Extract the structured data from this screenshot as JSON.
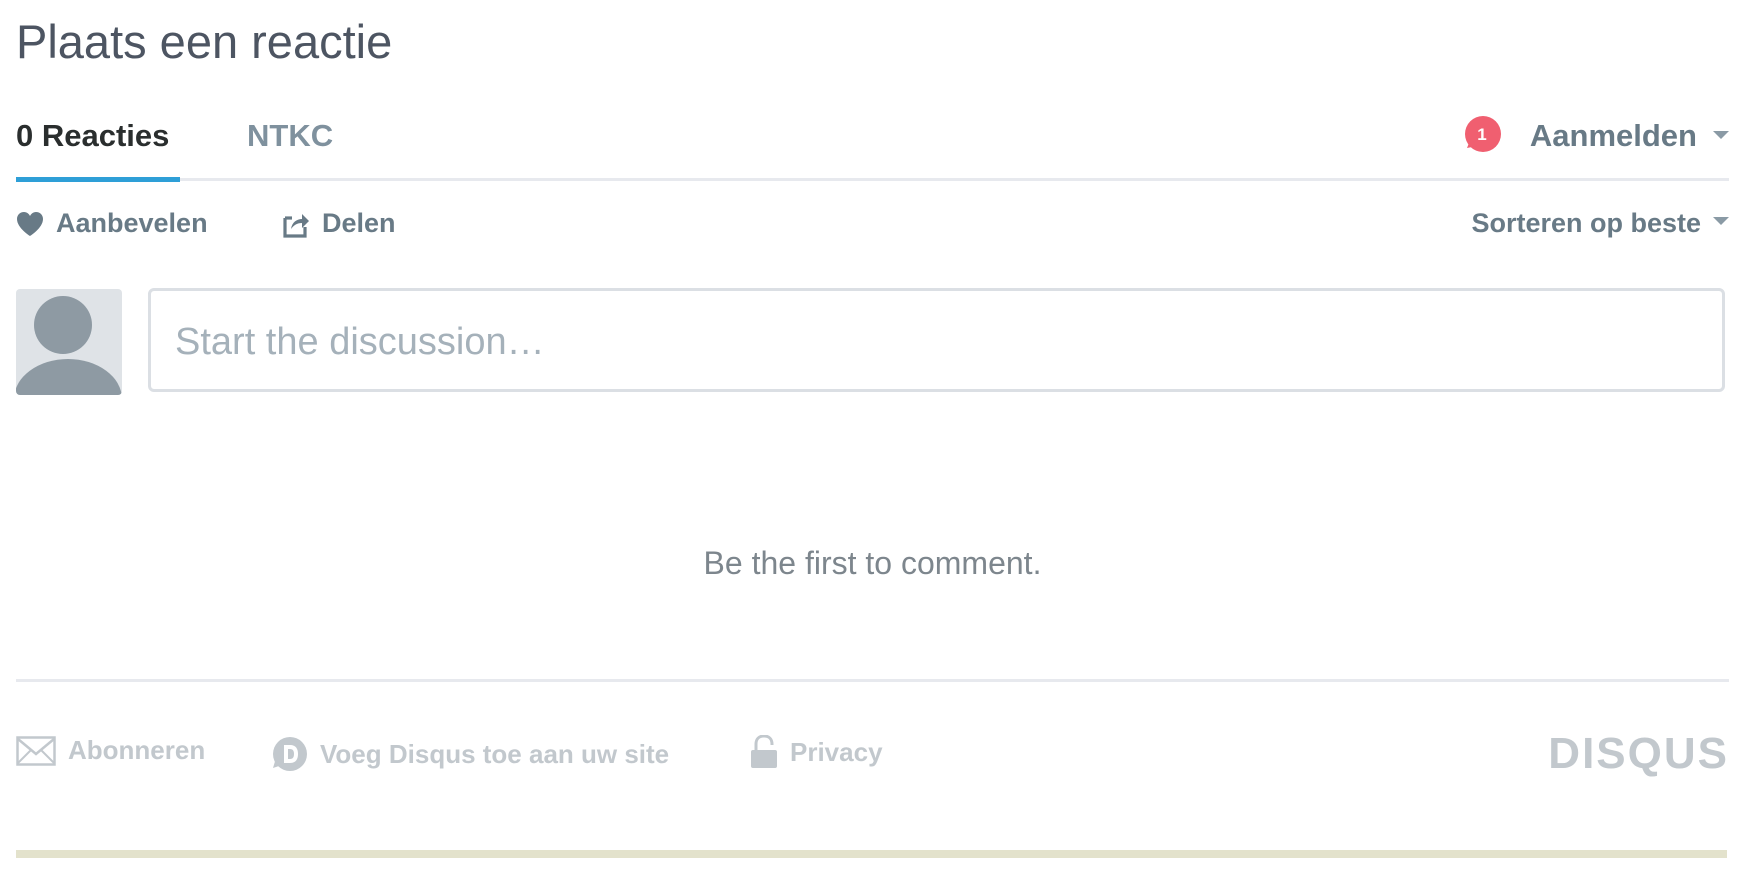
{
  "page": {
    "title": "Plaats een reactie"
  },
  "tabs": {
    "count_label": "0 Reacties",
    "forum_label": "NTKC"
  },
  "notifications": {
    "count": "1"
  },
  "login": {
    "label": "Aanmelden"
  },
  "actions": {
    "recommend_label": "Aanbevelen",
    "share_label": "Delen",
    "sort_label": "Sorteren op beste"
  },
  "composer": {
    "placeholder": "Start the discussion…"
  },
  "empty_state": {
    "message": "Be the first to comment."
  },
  "footer": {
    "subscribe_label": "Abonneren",
    "add_disqus_label": "Voeg Disqus toe aan uw site",
    "privacy_label": "Privacy",
    "brand": "DISQUS"
  },
  "colors": {
    "accent": "#2e9fd7",
    "badge": "#f05f70",
    "muted_text": "#687a86",
    "footer_text": "#c2c8cd"
  },
  "icons": [
    "heart-icon",
    "share-icon",
    "notification-bubble-icon",
    "avatar-icon",
    "mail-icon",
    "disqus-d-icon",
    "lock-icon"
  ]
}
